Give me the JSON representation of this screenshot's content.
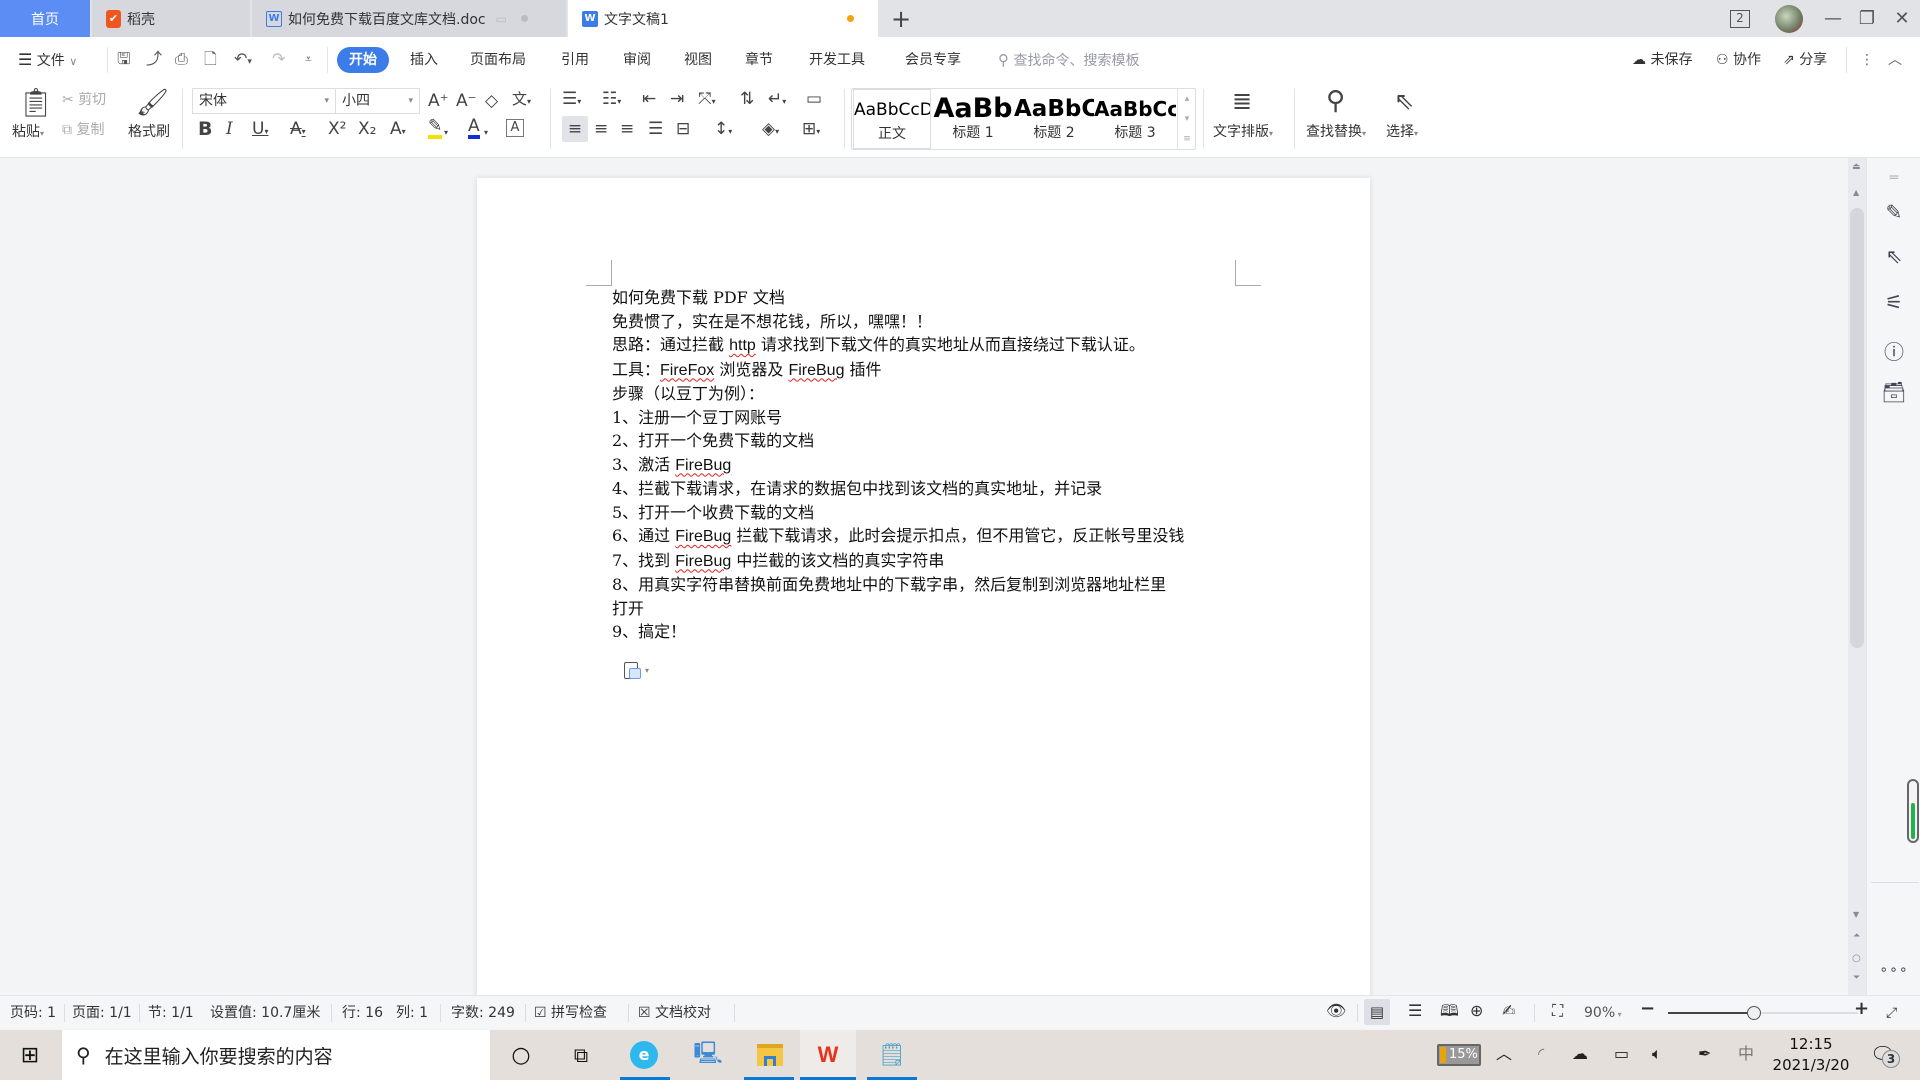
{
  "tabs": {
    "home": "首页",
    "shell": "稻壳",
    "doc": "如何免费下载百度文库文档.doc",
    "active": "文字文稿1",
    "new_tab": "+",
    "window_count": "2"
  },
  "menu": {
    "file": "文件",
    "items": [
      "开始",
      "插入",
      "页面布局",
      "引用",
      "审阅",
      "视图",
      "章节",
      "开发工具",
      "会员专享"
    ],
    "search_placeholder": "查找命令、搜索模板",
    "unsaved": "未保存",
    "collab": "协作",
    "share": "分享"
  },
  "ribbon": {
    "paste": "粘贴",
    "cut": "剪切",
    "copy": "复制",
    "format_painter": "格式刷",
    "font_name": "宋体",
    "font_size": "小四",
    "styles": [
      {
        "preview": "AaBbCcDd",
        "label": "正文"
      },
      {
        "preview": "AaBb",
        "label": "标题 1"
      },
      {
        "preview": "AaBbC",
        "label": "标题 2"
      },
      {
        "preview": "AaBbCc",
        "label": "标题 3"
      }
    ],
    "text_layout": "文字排版",
    "find_replace": "查找替换",
    "select": "选择"
  },
  "document": {
    "lines": [
      "如何免费下载 PDF 文档",
      "免费惯了，实在是不想花钱，所以，嘿嘿！！",
      "思路：通过拦截 http 请求找到下载文件的真实地址从而直接绕过下载认证。",
      "工具：FireFox 浏览器及 FireBug 插件",
      "步骤（以豆丁为例）：",
      "1、注册一个豆丁网账号",
      "2、打开一个免费下载的文档",
      "3、激活 FireBug",
      "4、拦截下载请求，在请求的数据包中找到该文档的真实地址，并记录",
      "5、打开一个收费下载的文档",
      "6、通过 FireBug 拦截下载请求，此时会提示扣点，但不用管它，反正帐号里没钱",
      "7、找到 FireBug 中拦截的该文档的真实字符串",
      "8、用真实字符串替换前面免费地址中的下载字串，然后复制到浏览器地址栏里",
      "打开",
      "9、搞定！"
    ]
  },
  "status": {
    "page_num": "页码: 1",
    "pages": "页面: 1/1",
    "section": "节: 1/1",
    "setting": "设置值: 10.7厘米",
    "row": "行: 16",
    "col": "列: 1",
    "word_count": "字数: 249",
    "spell_check": "拼写检查",
    "proofread": "文档校对",
    "zoom": "90%",
    "zoom_fraction": 0.45
  },
  "taskbar": {
    "search_placeholder": "在这里输入你要搜索的内容",
    "battery": "15%",
    "ime": "中",
    "time": "12:15",
    "date": "2021/3/20",
    "notifications": "3"
  }
}
